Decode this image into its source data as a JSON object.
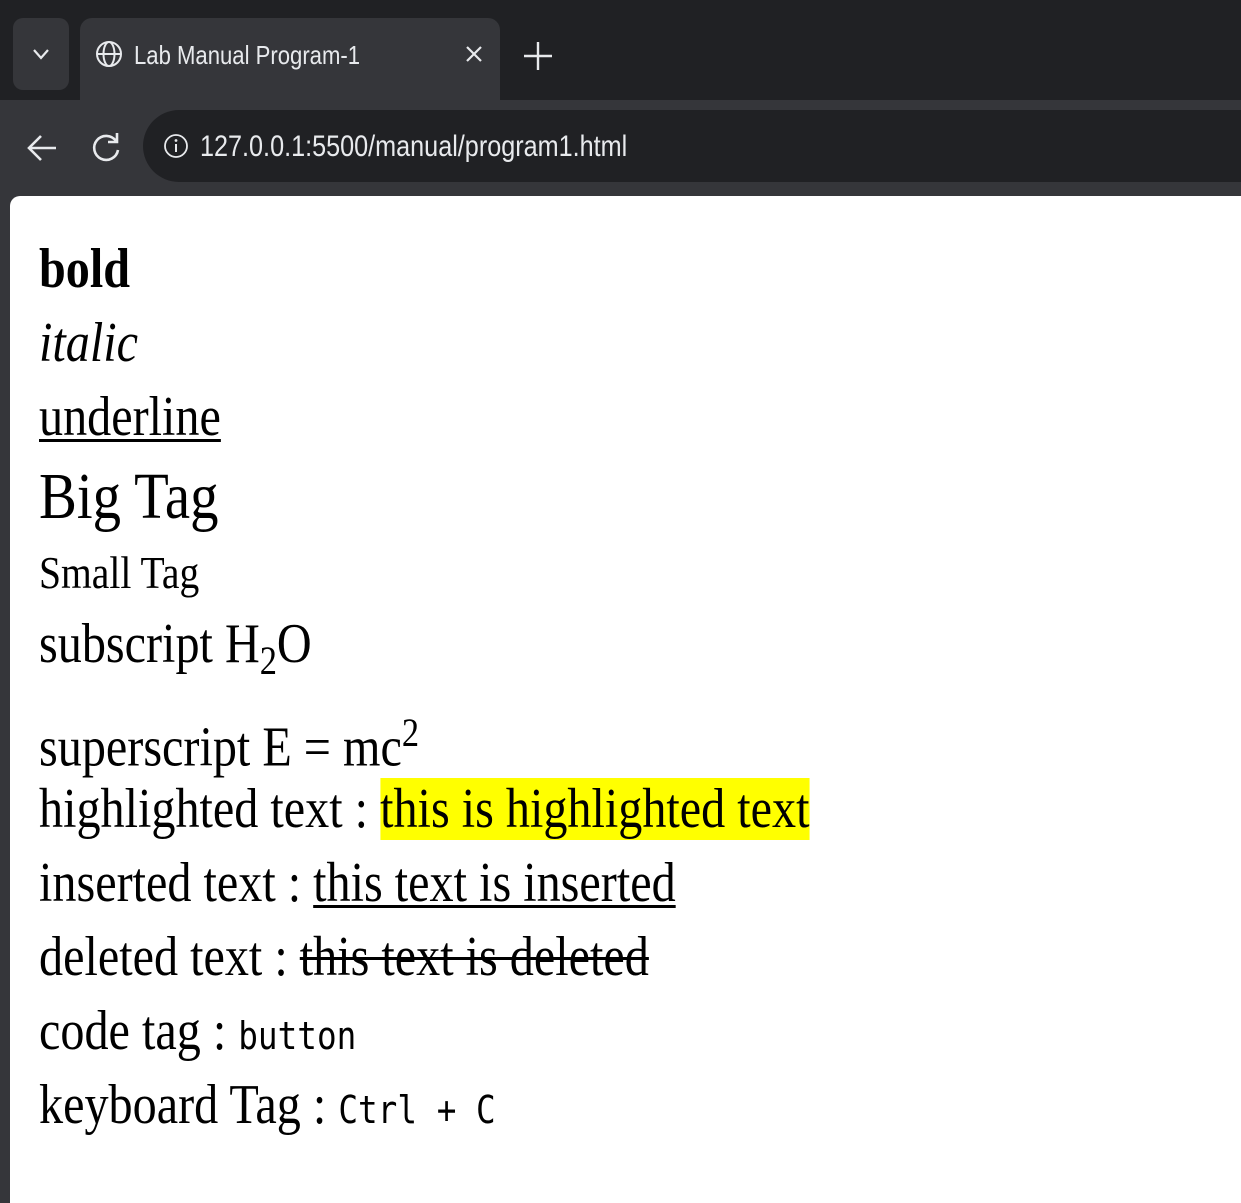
{
  "browser": {
    "tab_title": "Lab Manual Program-1",
    "url": "127.0.0.1:5500/manual/program1.html"
  },
  "page": {
    "bold": "bold",
    "italic": "italic",
    "underline": "underline",
    "big": "Big Tag",
    "small": "Small Tag",
    "subscript_label": "subscript H",
    "subscript_num": "2",
    "subscript_tail": "O",
    "superscript_label": "superscript E = mc",
    "superscript_num": "2",
    "highlighted_label": "highlighted text : ",
    "highlighted_value": "this is highlighted text",
    "inserted_label": "inserted text : ",
    "inserted_value": "this text is inserted",
    "deleted_label": "deleted text : ",
    "deleted_value": "this text is deleted",
    "code_label": "code tag : ",
    "code_value": "button",
    "keyboard_label": "keyboard Tag : ",
    "keyboard_value": "Ctrl + C"
  },
  "icons": {
    "tab_menu": "chevron-down-icon",
    "tab_favicon": "globe-icon",
    "tab_close": "close-icon",
    "new_tab": "plus-icon",
    "back": "arrow-left-icon",
    "reload": "reload-icon",
    "site_info": "info-icon"
  },
  "colors": {
    "chrome_dark": "#202124",
    "chrome_tab": "#35363a",
    "highlight": "#ffff00"
  }
}
